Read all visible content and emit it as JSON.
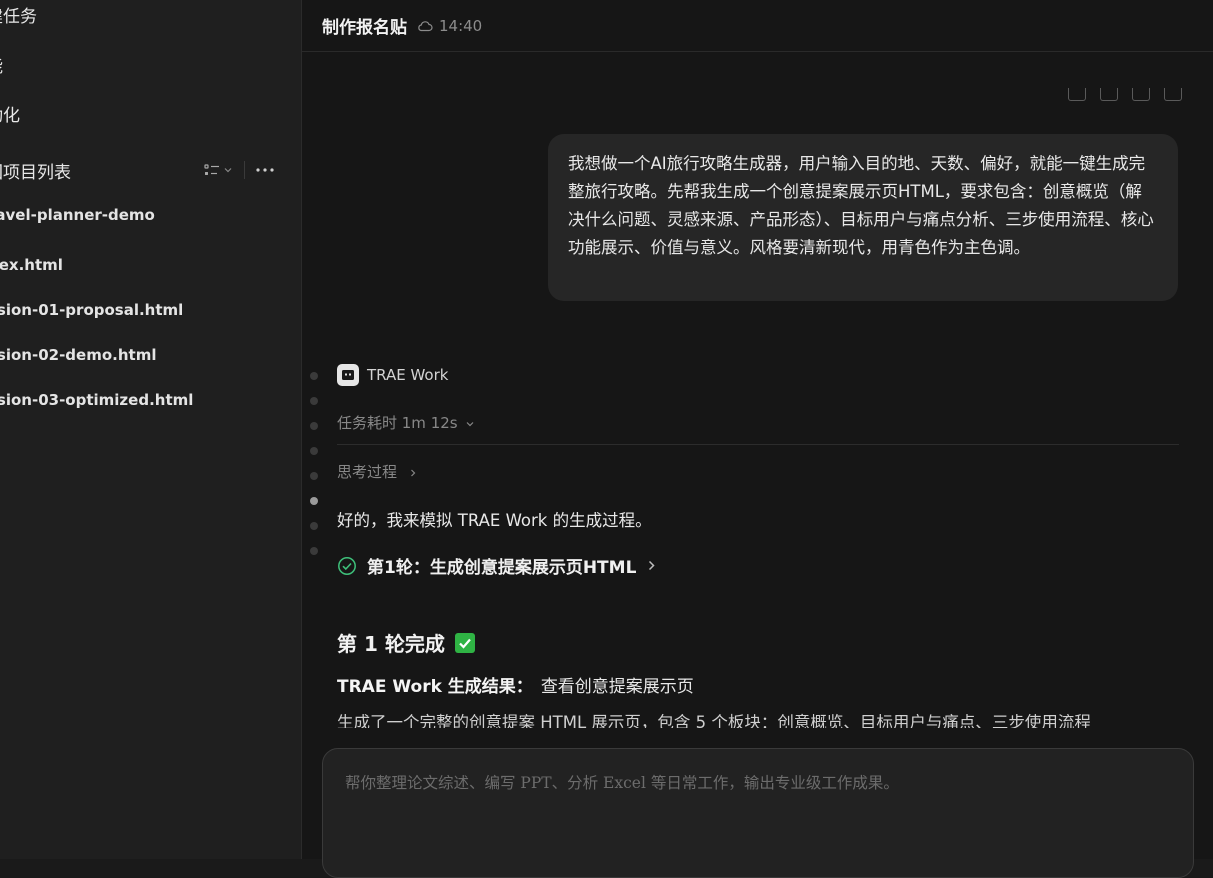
{
  "sidebar": {
    "nav_items": [
      {
        "label": "建任务"
      },
      {
        "label": "能"
      },
      {
        "label": "动化"
      }
    ],
    "projects_title": "回项目列表",
    "files": [
      {
        "label": "ravel-planner-demo"
      },
      {
        "label": "dex.html"
      },
      {
        "label": "ssion-01-proposal.html"
      },
      {
        "label": "ssion-02-demo.html"
      },
      {
        "label": "ssion-03-optimized.html"
      }
    ]
  },
  "header": {
    "title": "制作报名贴",
    "time": "14:40"
  },
  "user_message": {
    "text": "我想做一个AI旅行攻略生成器，用户输入目的地、天数、偏好，就能一键生成完整旅行攻略。先帮我生成一个创意提案展示页HTML，要求包含：创意概览（解决什么问题、灵感来源、产品形态）、目标用户与痛点分析、三步使用流程、核心功能展示、价值与意义。风格要清新现代，用青色作为主色调。"
  },
  "agent": {
    "name": "TRAE Work",
    "task_time": "任务耗时 1m 12s",
    "thinking_label": "思考过程",
    "reply": "好的，我来模拟 TRAE Work 的生成过程。",
    "round_label": "第1轮：生成创意提案展示页HTML",
    "done_heading": "第 1 轮完成",
    "result_label": "TRAE Work 生成结果：",
    "result_link": "查看创意提案展示页",
    "summary": "生成了一个完整的创意提案 HTML 展示页，包含 5 个板块：创意概览、目标用户与痛点、三步使用流程"
  },
  "composer": {
    "placeholder": "帮你整理论文综述、编写 PPT、分析 Excel 等日常工作，输出专业级工作成果。"
  },
  "colors": {
    "accent_green": "#2fb344",
    "background": "#161616"
  }
}
